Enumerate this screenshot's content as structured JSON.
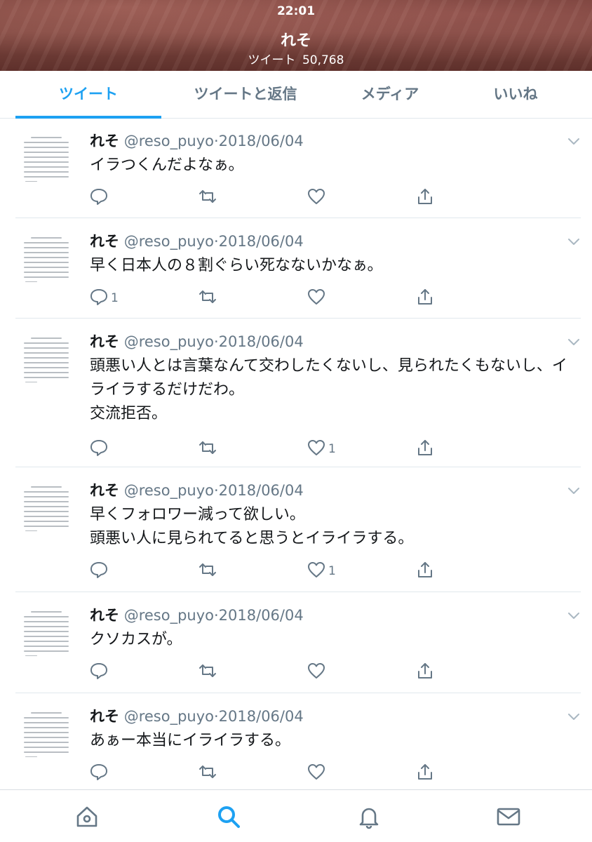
{
  "status_bar": {
    "time": "22:01"
  },
  "profile": {
    "name": "れそ",
    "tweet_count_label": "ツイート",
    "tweet_count": "50,768"
  },
  "tabs": [
    {
      "label": "ツイート",
      "active": true
    },
    {
      "label": "ツイートと返信",
      "active": false
    },
    {
      "label": "メディア",
      "active": false
    },
    {
      "label": "いいね",
      "active": false
    }
  ],
  "tweets": [
    {
      "name": "れそ",
      "handle": "@reso_puyo",
      "date": "2018/06/04",
      "text": "イラつくんだよなぁ。",
      "replies": "",
      "likes": ""
    },
    {
      "name": "れそ",
      "handle": "@reso_puyo",
      "date": "2018/06/04",
      "text": "早く日本人の８割ぐらい死なないかなぁ。",
      "replies": "1",
      "likes": ""
    },
    {
      "name": "れそ",
      "handle": "@reso_puyo",
      "date": "2018/06/04",
      "text": "頭悪い人とは言葉なんて交わしたくないし、見られたくもないし、イライラするだけだわ。\n交流拒否。",
      "replies": "",
      "likes": "1"
    },
    {
      "name": "れそ",
      "handle": "@reso_puyo",
      "date": "2018/06/04",
      "text": "早くフォロワー減って欲しい。\n頭悪い人に見られてると思うとイライラする。",
      "replies": "",
      "likes": "1"
    },
    {
      "name": "れそ",
      "handle": "@reso_puyo",
      "date": "2018/06/04",
      "text": "クソカスが。",
      "replies": "",
      "likes": ""
    },
    {
      "name": "れそ",
      "handle": "@reso_puyo",
      "date": "2018/06/04",
      "text": "あぁー本当にイライラする。",
      "replies": "",
      "likes": ""
    }
  ],
  "colors": {
    "accent": "#1da1f2",
    "muted": "#657786",
    "text": "#14171a",
    "border": "#e1e8ed"
  },
  "nav": [
    {
      "icon": "home-icon"
    },
    {
      "icon": "search-icon",
      "active": true
    },
    {
      "icon": "notifications-icon"
    },
    {
      "icon": "messages-icon"
    }
  ]
}
